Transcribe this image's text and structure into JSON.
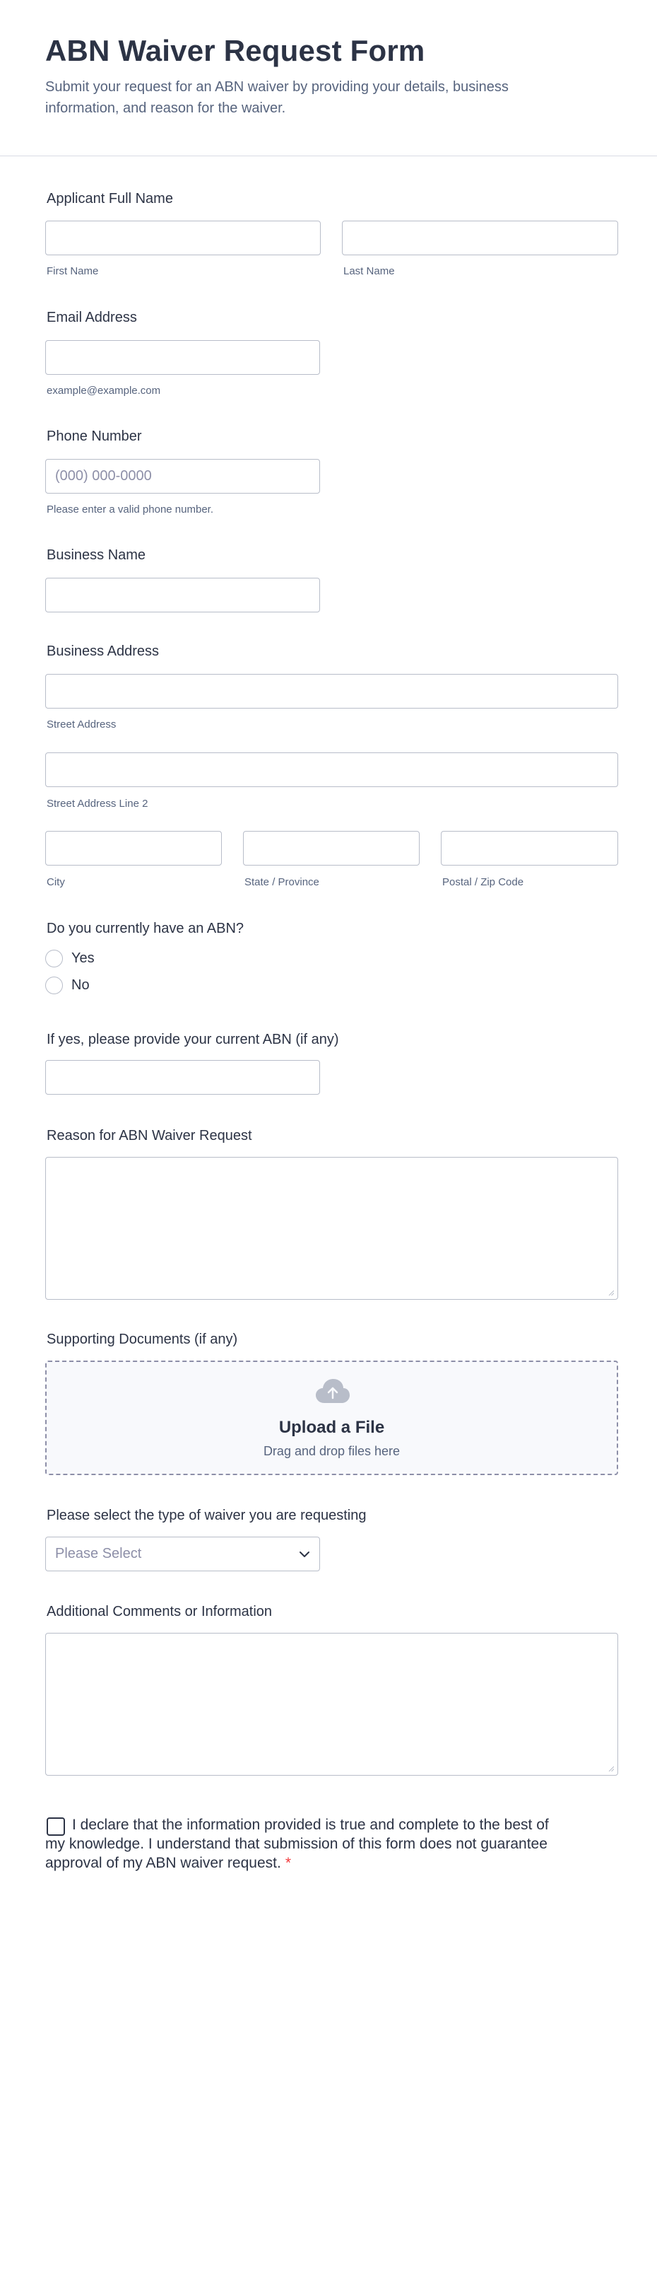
{
  "header": {
    "title": "ABN Waiver Request Form",
    "subtitle": "Submit your request for an ABN waiver by providing your details, business information, and reason for the waiver."
  },
  "applicant": {
    "label": "Applicant Full Name",
    "first_sublabel": "First Name",
    "last_sublabel": "Last Name",
    "first_value": "",
    "last_value": ""
  },
  "email": {
    "label": "Email Address",
    "sublabel": "example@example.com",
    "value": ""
  },
  "phone": {
    "label": "Phone Number",
    "placeholder": "(000) 000-0000",
    "sublabel": "Please enter a valid phone number."
  },
  "business_name": {
    "label": "Business Name",
    "value": ""
  },
  "business_address": {
    "label": "Business Address",
    "street_sublabel": "Street Address",
    "street2_sublabel": "Street Address Line 2",
    "city_sublabel": "City",
    "state_sublabel": "State / Province",
    "postal_sublabel": "Postal / Zip Code"
  },
  "has_abn": {
    "label": "Do you currently have an ABN?",
    "options": [
      "Yes",
      "No"
    ]
  },
  "current_abn": {
    "label": "If yes, please provide your current ABN (if any)",
    "value": ""
  },
  "reason": {
    "label": "Reason for ABN Waiver Request",
    "value": ""
  },
  "documents": {
    "label": "Supporting Documents (if any)",
    "icon": "cloud-upload-icon",
    "title": "Upload a File",
    "subtitle": "Drag and drop files here"
  },
  "waiver_type": {
    "label": "Please select the type of waiver you are requesting",
    "selected": "Please Select"
  },
  "comments": {
    "label": "Additional Comments or Information",
    "value": ""
  },
  "declaration": {
    "text": "I declare that the information provided is true and complete to the best of my knowledge. I understand that submission of this form does not guarantee approval of my ABN waiver request.",
    "required_mark": "*"
  },
  "colors": {
    "text": "#2c3345",
    "muted": "#57647e",
    "border": "#b8bdc9",
    "required": "#f23a3c",
    "upload_bg": "#f8f9fc"
  }
}
